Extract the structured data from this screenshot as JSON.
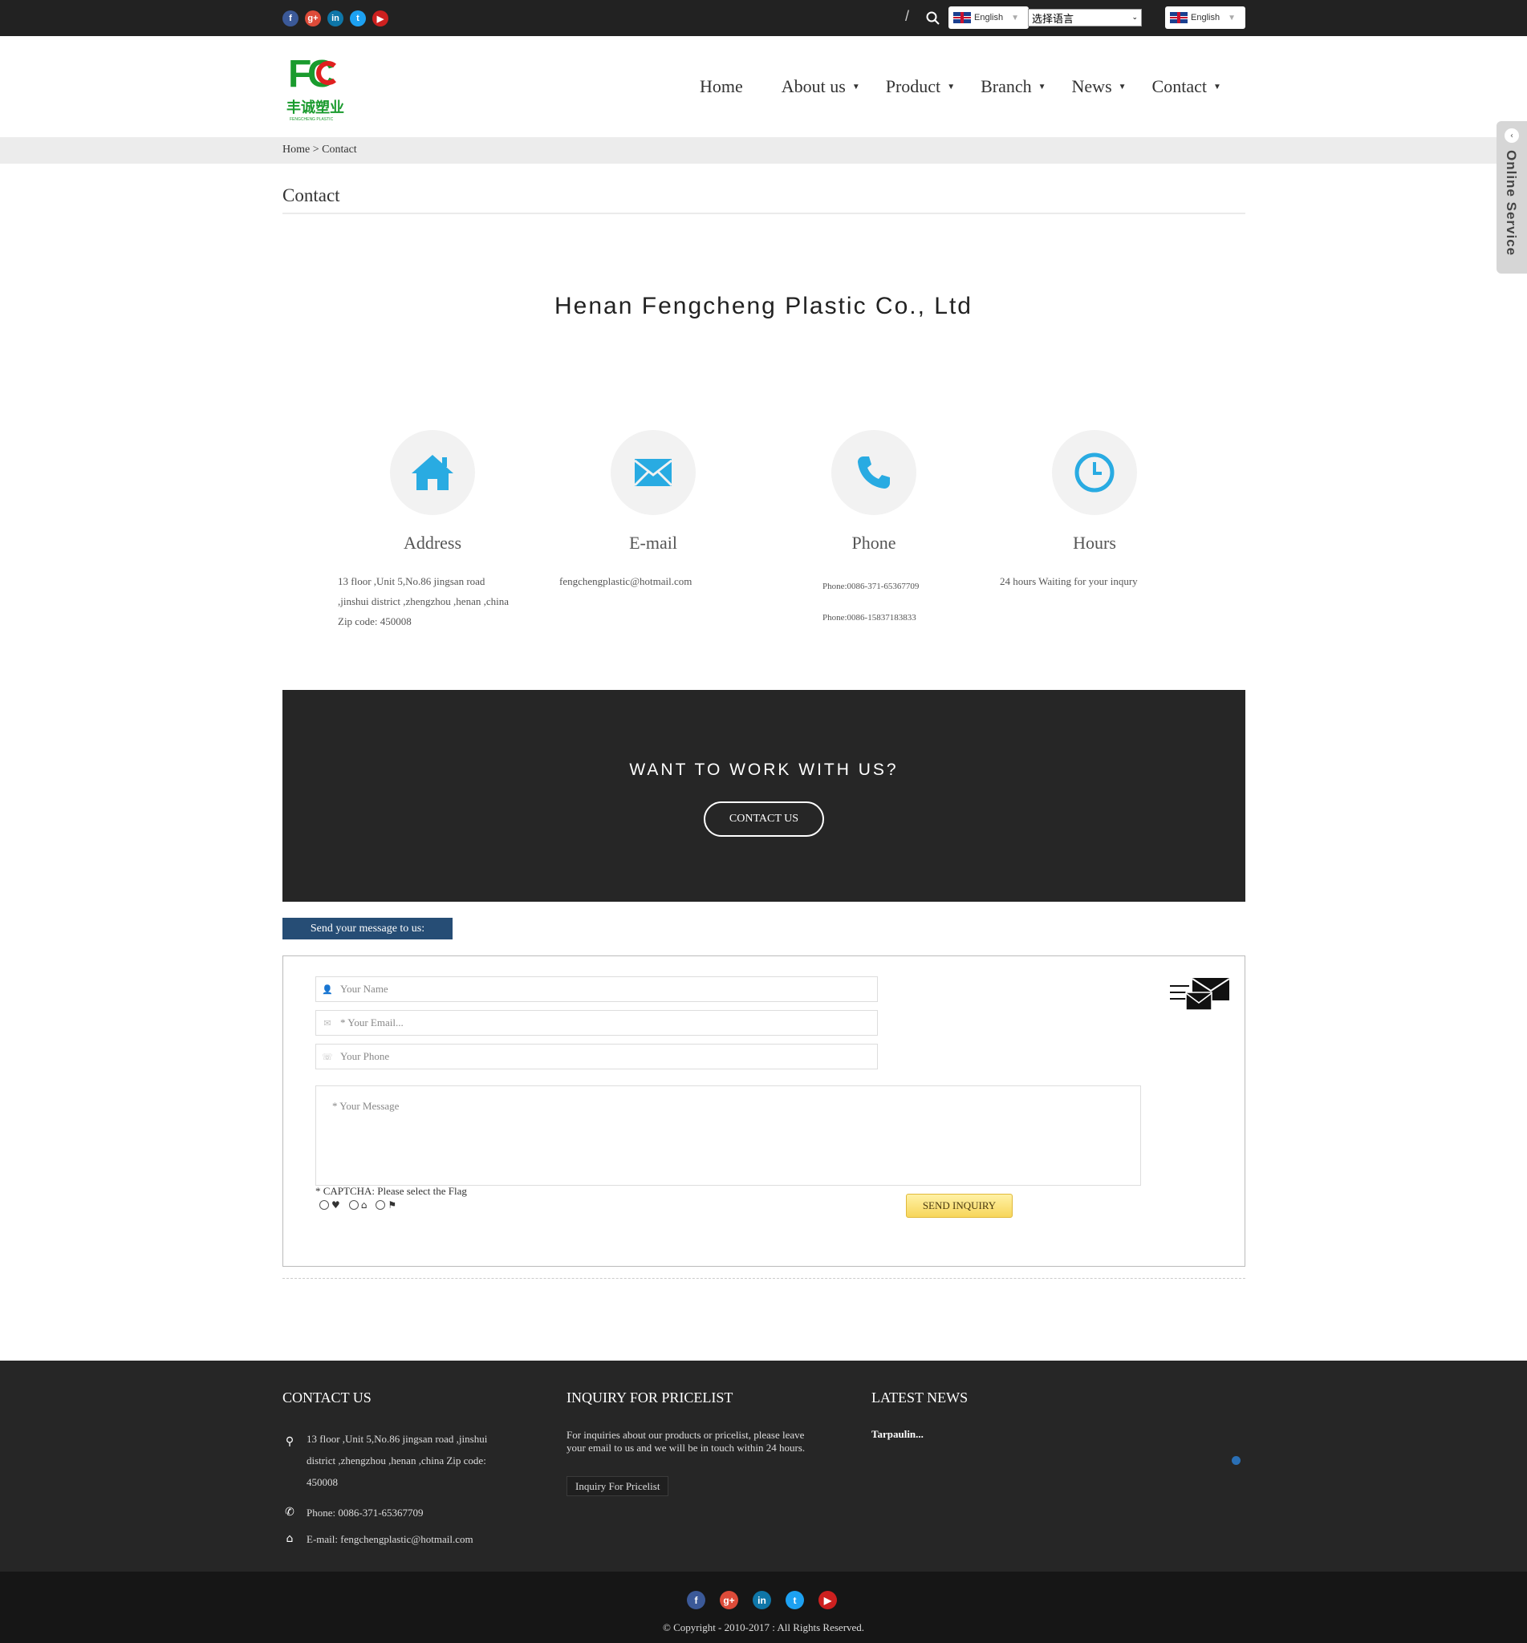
{
  "topbar": {
    "social": [
      {
        "icon": "facebook-icon",
        "glyph": "f",
        "color": "#3b5998"
      },
      {
        "icon": "google-plus-icon",
        "glyph": "g+",
        "color": "#dd4b39"
      },
      {
        "icon": "linkedin-icon",
        "glyph": "in",
        "color": "#0e76a8"
      },
      {
        "icon": "twitter-icon",
        "glyph": "t",
        "color": "#1da1f2"
      },
      {
        "icon": "youtube-icon",
        "glyph": "▶",
        "color": "#cd201f"
      }
    ],
    "lang_left": "English",
    "lang_select": "选择语言",
    "lang_right": "English"
  },
  "nav": {
    "items": [
      {
        "label": "Home",
        "dropdown": false
      },
      {
        "label": "About us",
        "dropdown": true
      },
      {
        "label": "Product",
        "dropdown": true
      },
      {
        "label": "Branch",
        "dropdown": true
      },
      {
        "label": "News",
        "dropdown": true
      },
      {
        "label": "Contact",
        "dropdown": true
      }
    ]
  },
  "logo": {
    "letters": "FC",
    "chinese": "丰诚塑业",
    "sub": "FENGCHENG PLASTIC"
  },
  "breadcrumb": {
    "home": "Home",
    "sep": ">",
    "current": "Contact"
  },
  "sidetab": {
    "label": "Online Service"
  },
  "page": {
    "title": "Contact",
    "company": "Henan Fengcheng Plastic Co., Ltd"
  },
  "cards": {
    "address": {
      "label": "Address",
      "lines": [
        "13 floor ,Unit 5,No.86 jingsan road",
        ",jinshui district ,zhengzhou ,henan ,china",
        "Zip code: 450008"
      ]
    },
    "email": {
      "label": "E-mail",
      "lines": [
        "fengchengplastic@hotmail.com"
      ]
    },
    "phone": {
      "label": "Phone",
      "lines": [
        "Phone:0086-371-65367709",
        "Phone:0086-15837183833"
      ]
    },
    "hours": {
      "label": "Hours",
      "lines": [
        "24 hours Waiting for your inqury"
      ]
    }
  },
  "cta": {
    "question": "WANT TO WORK WITH US?",
    "button": "CONTACT US"
  },
  "form": {
    "tab": "Send your message to us:",
    "name_placeholder": "Your Name",
    "email_placeholder": "* Your Email...",
    "phone_placeholder": "Your Phone",
    "message_placeholder": "* Your Message",
    "captcha": "* CAPTCHA: Please select the Flag",
    "send": "SEND INQUIRY"
  },
  "footer": {
    "contact_head": "CONTACT US",
    "address_lines": [
      "13 floor ,Unit 5,No.86 jingsan road ,jinshui",
      "district ,zhengzhou ,henan ,china Zip code:",
      "450008"
    ],
    "phone": "Phone: 0086-371-65367709",
    "email": "E-mail: fengchengplastic@hotmail.com",
    "inquiry_head": "INQUIRY FOR PRICELIST",
    "inquiry_text": "For inquiries about our products or pricelist, please leave your email to us and we will be in touch within 24 hours.",
    "inquiry_button": "Inquiry For Pricelist",
    "news_head": "LATEST NEWS",
    "news_item": "Tarpaulin...",
    "copyright": "© Copyright - 2010-2017 : All Rights Reserved."
  }
}
